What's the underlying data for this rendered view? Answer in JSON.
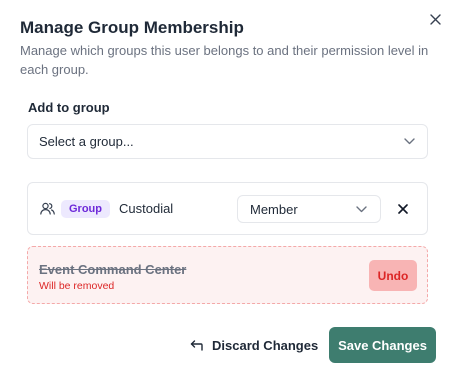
{
  "dialog": {
    "title": "Manage Group Membership",
    "description": "Manage which groups this user belongs to and their permission level in each group."
  },
  "add_to_group": {
    "label": "Add to group",
    "select_value": "Select a group..."
  },
  "memberships": [
    {
      "badge": "Group",
      "name": "Custodial",
      "role": "Member"
    }
  ],
  "pending_removal": {
    "name": "Event Command Center",
    "note": "Will be removed",
    "undo_label": "Undo"
  },
  "footer": {
    "discard_label": "Discard Changes",
    "save_label": "Save Changes"
  },
  "colors": {
    "save_button": "#3e7d6f",
    "badge_bg": "#ede9fe",
    "badge_text": "#6d28d9",
    "removed_bg": "#fdf2f2",
    "danger": "#dc2626"
  },
  "icons": {
    "close": "close-icon",
    "chevron": "chevron-down-icon",
    "users": "users-icon",
    "remove": "remove-icon",
    "undo": "undo-arrow-icon"
  }
}
